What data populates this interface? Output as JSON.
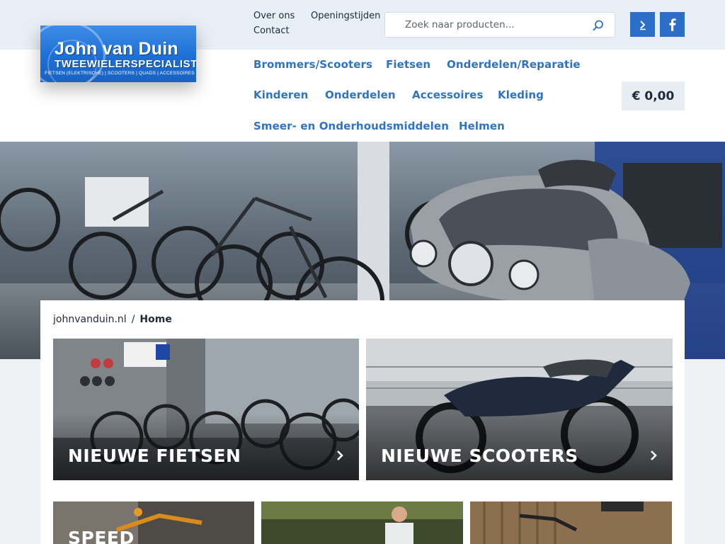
{
  "colors": {
    "brand_blue": "#2d73c8",
    "social_blue": "#2c6fc9",
    "topbar_bg": "#e7eef5",
    "cart_bg": "#e7edf3"
  },
  "logo": {
    "name": "John van Duin",
    "subtitle": "TWEEWIELERSPECIALIST",
    "tagline": "FIETSEN (ELEKTRISCHE) | SCOOTERS | QUADS | ACCESSOIRES"
  },
  "top_links": {
    "about": "Over ons",
    "hours": "Openingstijden",
    "contact": "Contact"
  },
  "search": {
    "placeholder": "Zoek naar producten...",
    "icon": "search-icon"
  },
  "social": {
    "route_icon": "route-icon",
    "facebook_icon": "facebook-icon"
  },
  "nav": [
    "Brommers/Scooters",
    "Fietsen",
    "Onderdelen/Reparatie",
    "Kinderen",
    "Onderdelen",
    "Accessoires",
    "Kleding",
    "Smeer- en Onderhoudsmiddelen",
    "Helmen"
  ],
  "cart": {
    "total": "€ 0,00"
  },
  "breadcrumb": {
    "root": "johnvanduin.nl",
    "separator": "/",
    "current": "Home"
  },
  "tiles": [
    {
      "label": "NIEUWE FIETSEN",
      "icon": "chevron-right-icon"
    },
    {
      "label": "NIEUWE SCOOTERS",
      "icon": "chevron-right-icon"
    },
    {
      "label": "SPEED"
    }
  ]
}
